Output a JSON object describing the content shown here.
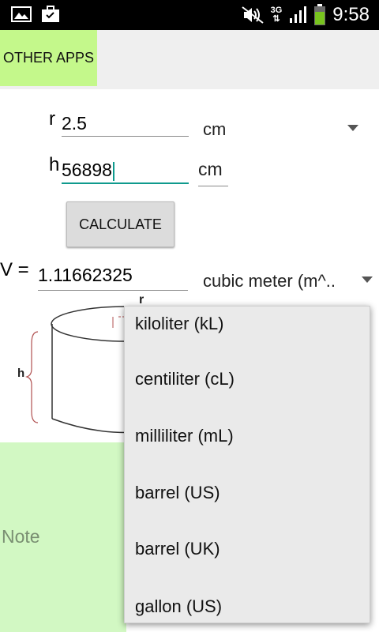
{
  "status_bar": {
    "time": "9:58",
    "network": "3G",
    "icons": [
      "gallery-icon",
      "briefcase-icon",
      "mute-icon",
      "signal-icon",
      "battery-icon"
    ]
  },
  "topbar": {
    "other_apps_label": "OTHER APPS"
  },
  "inputs": {
    "r_label": "r",
    "r_value": "2.5",
    "r_unit": "cm",
    "h_label": "h",
    "h_value": "56898",
    "h_unit": "cm"
  },
  "calculate_label": "CALCULATE",
  "result": {
    "label": "V =",
    "value": "1.11662325",
    "unit": "cubic meter (m^.."
  },
  "diagram": {
    "r_label": "r",
    "h_label": "h"
  },
  "note_label": "Note",
  "dropdown": {
    "options": [
      "kiloliter (kL)",
      "centiliter (cL)",
      "milliliter (mL)",
      "barrel (US)",
      "barrel (UK)",
      "gallon (US)"
    ]
  },
  "colors": {
    "accent": "#0f9a8d",
    "other_apps_bg": "#c4f88b",
    "note_bg": "#d2f8c3"
  }
}
